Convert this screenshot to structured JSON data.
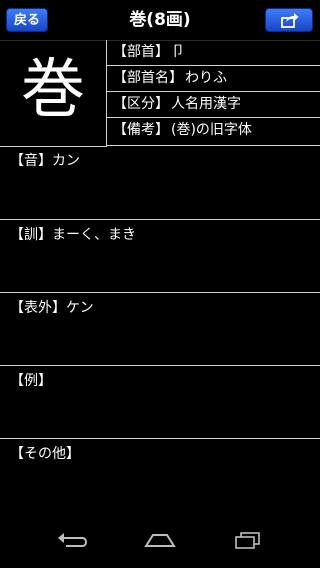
{
  "header": {
    "back_label": "戻る",
    "title": "巻(8画)",
    "share_icon": "share-icon"
  },
  "kanji": {
    "character": "巻"
  },
  "info": [
    {
      "label": "【部首】",
      "value": "卩"
    },
    {
      "label": "【部首名】",
      "value": "わりふ"
    },
    {
      "label": "【区分】",
      "value": "人名用漢字"
    },
    {
      "label": "【備考】",
      "value": "(巻)の旧字体"
    }
  ],
  "sections": [
    {
      "label": "【音】",
      "value": "カン"
    },
    {
      "label": "【訓】",
      "value": "まーく、まき"
    },
    {
      "label": "【表外】",
      "value": "ケン"
    },
    {
      "label": "【例】",
      "value": ""
    },
    {
      "label": "【その他】",
      "value": ""
    }
  ],
  "navigation": {
    "back_icon": "back-icon",
    "home_icon": "home-icon",
    "recents_icon": "recents-icon"
  },
  "colors": {
    "background": "#000000",
    "accent": "#2a5ce0",
    "divider": "#cfcfcf"
  }
}
